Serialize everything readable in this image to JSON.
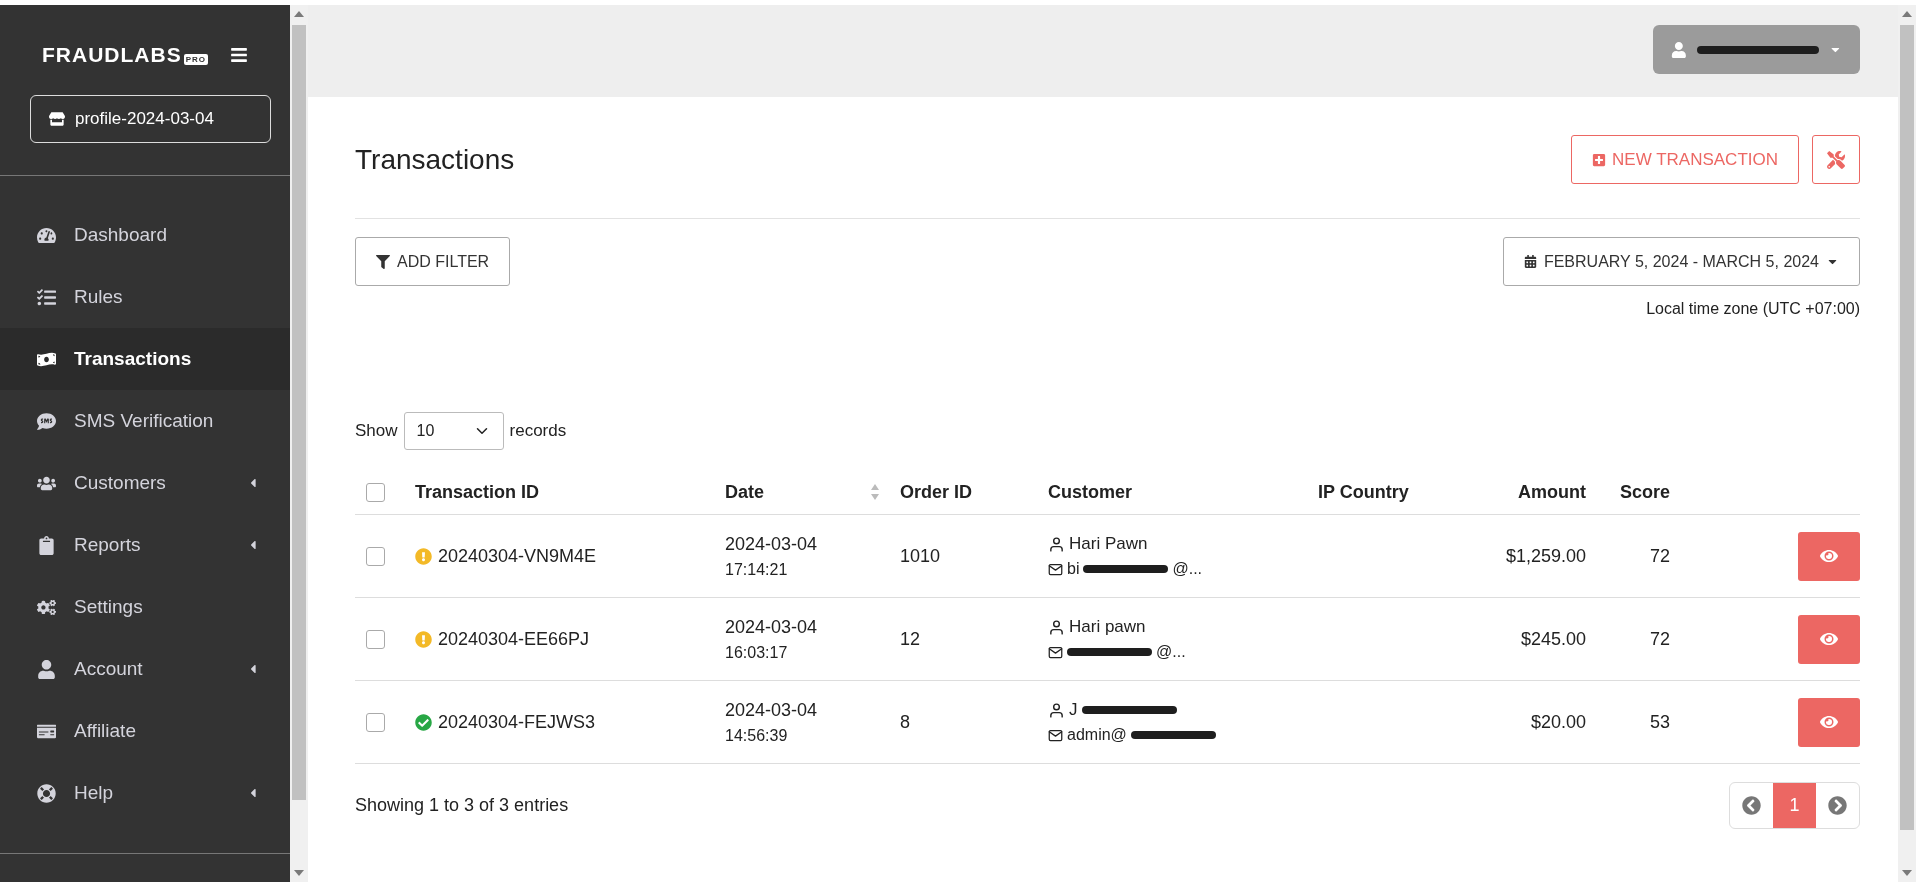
{
  "sidebar": {
    "logo": "FRAUDLABS",
    "logo_badge": "PRO",
    "profile": "profile-2024-03-04",
    "items": [
      {
        "label": "Dashboard",
        "selected": false,
        "has_submenu": false
      },
      {
        "label": "Rules",
        "selected": false,
        "has_submenu": false
      },
      {
        "label": "Transactions",
        "selected": true,
        "has_submenu": false
      },
      {
        "label": "SMS Verification",
        "selected": false,
        "has_submenu": false
      },
      {
        "label": "Customers",
        "selected": false,
        "has_submenu": true
      },
      {
        "label": "Reports",
        "selected": false,
        "has_submenu": true
      },
      {
        "label": "Settings",
        "selected": false,
        "has_submenu": false
      },
      {
        "label": "Account",
        "selected": false,
        "has_submenu": true
      },
      {
        "label": "Affiliate",
        "selected": false,
        "has_submenu": false
      },
      {
        "label": "Help",
        "selected": false,
        "has_submenu": true
      }
    ]
  },
  "page": {
    "title": "Transactions",
    "new_button": "NEW TRANSACTION",
    "filter_button": "ADD FILTER",
    "date_range": "FEBRUARY 5, 2024 - MARCH 5, 2024",
    "timezone": "Local time zone (UTC +07:00)"
  },
  "records": {
    "show": "Show",
    "value": "10",
    "suffix": "records"
  },
  "table": {
    "all_selected": false,
    "columns": [
      "Transaction ID",
      "Date",
      "Order ID",
      "Customer",
      "IP Country",
      "Amount",
      "Score"
    ],
    "rows": [
      {
        "selected": false,
        "kind": "warning",
        "id": "20240304-VN9M4E",
        "date": "2024-03-04",
        "time": "17:14:21",
        "order": "1010",
        "name": "Hari Pawn",
        "name_redacted": false,
        "email_start": "bi",
        "email_end": "@...",
        "amount": "$1,259.00",
        "score": "72"
      },
      {
        "selected": false,
        "kind": "warning",
        "id": "20240304-EE66PJ",
        "date": "2024-03-04",
        "time": "16:03:17",
        "order": "12",
        "name": "Hari pawn",
        "name_redacted": false,
        "email_start": "",
        "email_end": "@...",
        "amount": "$245.00",
        "score": "72"
      },
      {
        "selected": false,
        "kind": "ok",
        "id": "20240304-FEJWS3",
        "date": "2024-03-04",
        "time": "14:56:39",
        "order": "8",
        "name": "J",
        "name_redacted": true,
        "email_start": "admin@",
        "email_end": "",
        "amount": "$20.00",
        "score": "53"
      }
    ]
  },
  "footer": {
    "summary": "Showing 1 to 3 of 3 entries",
    "pages": [
      {
        "label": "1",
        "selected": true
      }
    ]
  }
}
